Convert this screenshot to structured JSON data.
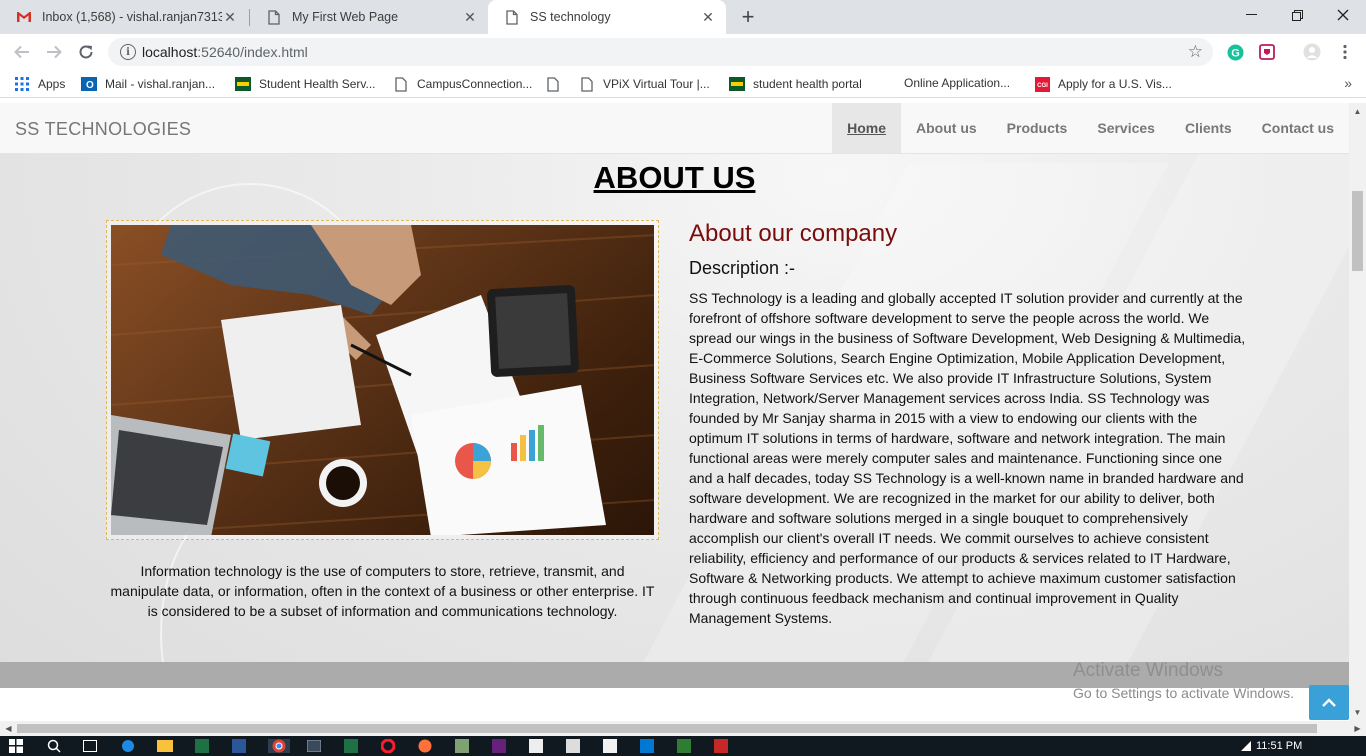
{
  "browser": {
    "tabs": [
      {
        "title": "Inbox (1,568) - vishal.ranjan7313",
        "icon": "gmail-icon",
        "active": false
      },
      {
        "title": "My First Web Page",
        "icon": "page-icon",
        "active": false
      },
      {
        "title": "SS technology",
        "icon": "page-icon",
        "active": true
      }
    ],
    "url_host": "localhost",
    "url_rest": ":52640/index.html",
    "bookmarks": [
      {
        "label": "Apps",
        "icon": "apps-grid-icon"
      },
      {
        "label": "Mail - vishal.ranjan...",
        "icon": "outlook-icon"
      },
      {
        "label": "Student Health Serv...",
        "icon": "ndsu-icon"
      },
      {
        "label": "CampusConnection...",
        "icon": "page-icon"
      },
      {
        "label": "",
        "icon": "page-icon"
      },
      {
        "label": "VPiX Virtual Tour |...",
        "icon": "page-icon"
      },
      {
        "label": "student health portal",
        "icon": "ndsu-icon"
      },
      {
        "label": "Online Application...",
        "icon": "none"
      },
      {
        "label": "Apply for a U.S. Vis...",
        "icon": "cgi-icon"
      }
    ]
  },
  "site": {
    "brand": "SS TECHNOLOGIES",
    "nav": [
      "Home",
      "About us",
      "Products",
      "Services",
      "Clients",
      "Contact us"
    ],
    "heading": "ABOUT US",
    "caption": "Information technology is the use of computers to store, retrieve, transmit, and manipulate data, or information, often in the context of a business or other enterprise. IT is considered to be a subset of information and communications technology.",
    "about_title": "About our company",
    "desc_label": "Description :-",
    "description": "SS Technology is a leading and globally accepted IT solution provider and currently at the forefront of offshore software development to serve the people across the world. We spread our wings in the business of Software Development, Web Designing & Multimedia, E-Commerce Solutions, Search Engine Optimization, Mobile Application Development, Business Software Services etc. We also provide IT Infrastructure Solutions, System Integration, Network/Server Management services across India. SS Technology was founded by Mr Sanjay sharma in 2015 with a view to endowing our clients with the optimum IT solutions in terms of hardware, software and network integration. The main functional areas were merely computer sales and maintenance. Functioning since one and a half decades, today SS Technology is a well-known name in branded hardware and software development. We are recognized in the market for our ability to deliver, both hardware and software solutions merged in a single bouquet to comprehensively accomplish our client's overall IT needs. We commit ourselves to achieve consistent reliability, efficiency and performance of our products & services related to IT Hardware, Software & Networking products. We attempt to achieve maximum customer satisfaction through continuous feedback mechanism and continual improvement in Quality Management Systems."
  },
  "os": {
    "watermark_title": "Activate Windows",
    "watermark_sub": "Go to Settings to activate Windows.",
    "clock": "11:51 PM"
  },
  "colors": {
    "about_title": "#7a0c0c",
    "totop_button": "#3aa0d8",
    "gmail_red": "#d93025"
  }
}
